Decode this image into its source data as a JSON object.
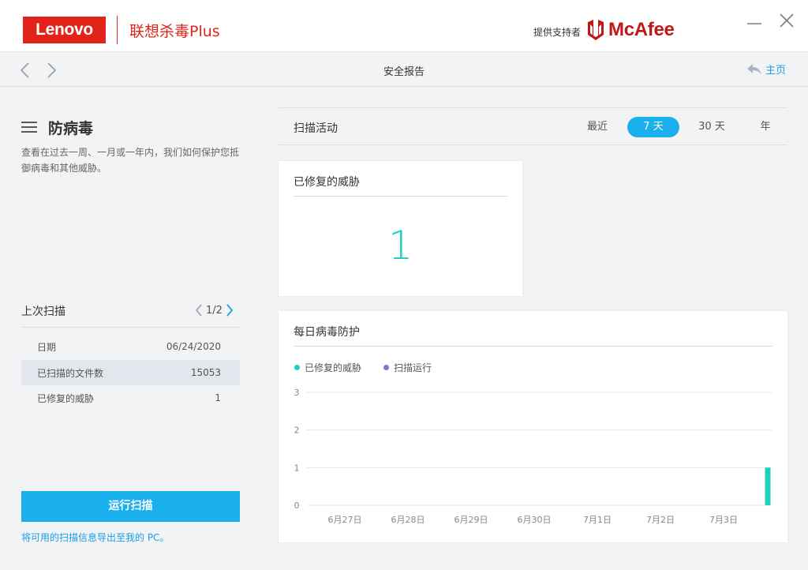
{
  "titlebar": {
    "brand_logo_text": "Lenovo",
    "product_name": "联想杀毒Plus",
    "powered_by": "提供支持者",
    "partner_logo_text": "McAfee",
    "brand_color": "#e2231a",
    "partner_color": "#c01818"
  },
  "nav": {
    "title": "安全报告",
    "home_label": "主页"
  },
  "left": {
    "title": "防病毒",
    "description": "查看在过去一周、一月或一年内，我们如何保护您抵御病毒和其他威胁。",
    "last_scan": {
      "title": "上次扫描",
      "pager": "1/2",
      "rows": [
        {
          "label": "日期",
          "value": "06/24/2020"
        },
        {
          "label": "已扫描的文件数",
          "value": "15053"
        },
        {
          "label": "已修复的威胁",
          "value": "1"
        }
      ]
    },
    "run_scan_label": "运行扫描",
    "export_label": "将可用的扫描信息导出至我的 PC。"
  },
  "activity": {
    "title": "扫描活动",
    "tabs": [
      {
        "label": "最近",
        "active": false
      },
      {
        "label": "7 天",
        "active": true
      },
      {
        "label": "30 天",
        "active": false
      },
      {
        "label": "年",
        "active": false
      }
    ],
    "accent_color": "#1ab0ee"
  },
  "threats_card": {
    "title": "已修复的威胁",
    "count": "1"
  },
  "daily_card": {
    "title": "每日病毒防护"
  },
  "chart_data": {
    "type": "bar",
    "title": "每日病毒防护",
    "categories": [
      "6月27日",
      "6月28日",
      "6月29日",
      "6月30日",
      "7月1日",
      "7月2日",
      "7月3日"
    ],
    "series": [
      {
        "name": "已修复的威胁",
        "color": "#1fd0c0",
        "values": [
          0,
          0,
          0,
          0,
          0,
          0,
          1
        ]
      },
      {
        "name": "扫描运行",
        "color": "#8c6fd8",
        "values": [
          0,
          0,
          0,
          0,
          0,
          0,
          0
        ]
      }
    ],
    "yticks": [
      "0",
      "1",
      "2",
      "3"
    ],
    "ylim": [
      0,
      3
    ],
    "grid": true,
    "legend": "top-left"
  }
}
